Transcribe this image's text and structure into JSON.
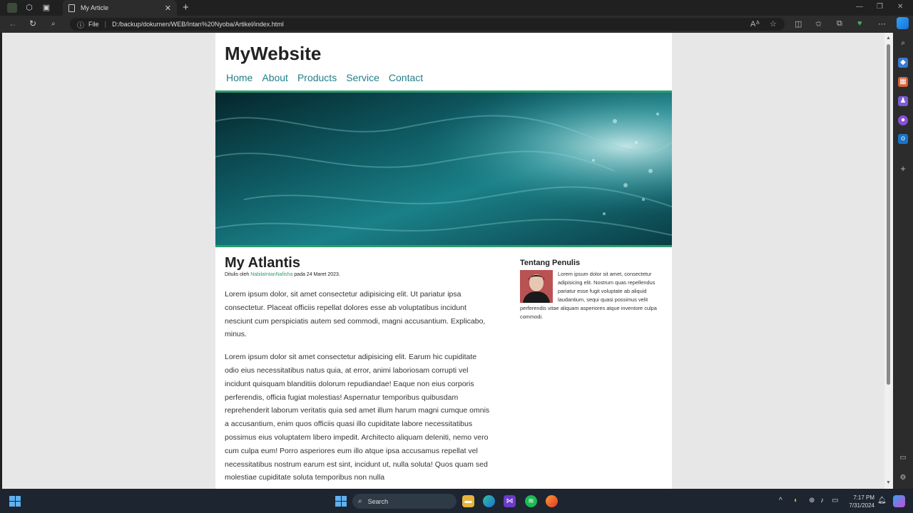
{
  "browser": {
    "tab_title": "My Article",
    "close_glyph": "✕",
    "new_tab_glyph": "+",
    "url_scheme": "File",
    "url": "D:/backup/dokumen/WEB/Intan%20Nyoba/Artikel/index.html"
  },
  "site": {
    "title": "MyWebsite",
    "menu": [
      "Home",
      "About",
      "Products",
      "Service",
      "Contact"
    ]
  },
  "article": {
    "title": "My Atlantis",
    "byline_prefix": "Ditulis oleh ",
    "author": "NabilaIntanNafisha",
    "byline_suffix": " pada 24 Maret 2023.",
    "paragraph1": "Lorem ipsum dolor, sit amet consectetur adipisicing elit. Ut pariatur ipsa consectetur. Placeat officiis repellat dolores esse ab voluptatibus incidunt nesciunt cum perspiciatis autem sed commodi, magni accusantium. Explicabo, minus.",
    "paragraph2": "Lorem ipsum dolor sit amet consectetur adipisicing elit. Earum hic cupiditate odio eius necessitatibus natus quia, at error, animi laboriosam corrupti vel incidunt quisquam blanditiis dolorum repudiandae! Eaque non eius corporis perferendis, officia fugiat molestias! Aspernatur temporibus quibusdam reprehenderit laborum veritatis quia sed amet illum harum magni cumque omnis a accusantium, enim quos officiis quasi illo cupiditate labore necessitatibus possimus eius voluptatem libero impedit. Architecto aliquam deleniti, nemo vero cum culpa eum! Porro asperiores eum illo atque ipsa accusamus repellat vel necessitatibus nostrum earum est sint, incidunt ut, nulla soluta! Quos quam sed molestiae cupiditate soluta temporibus non nulla"
  },
  "aside": {
    "title": "Tentang Penulis",
    "body": "Lorem ipsum dolor sit amet, consectetur adipisicing elit. Nostrum quas repellendus pariatur esse fugit voluptate ab aliquid laudantium, sequi quasi possimus velit perferendis vitae aliquam asperiores atque inventore culpa commodi."
  },
  "taskbar": {
    "search_placeholder": "Search",
    "time": "7:17 PM",
    "date": "7/31/2024"
  },
  "colors": {
    "accent_teal": "#1f7f8a",
    "accent_green": "#2d9d6d"
  }
}
